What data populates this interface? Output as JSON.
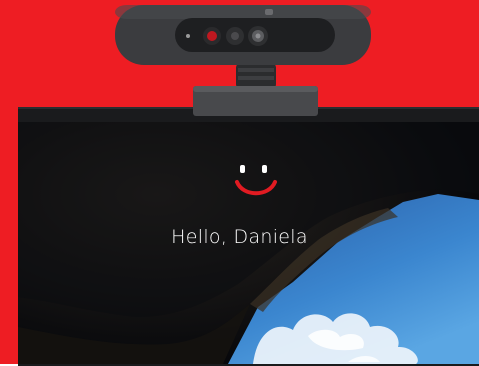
{
  "greeting": {
    "text": "Hello, Daniela"
  },
  "colors": {
    "background_red": "#ee1d23",
    "webcam_body": "#3b3c3f",
    "screen_dark": "#0d0f14",
    "sky_blue": "#2f6fb8",
    "smile_red": "#e11b22",
    "eye_white": "#ffffff"
  },
  "icons": {
    "smiley": "windows-hello-smiley-icon",
    "webcam": "webcam-icon"
  }
}
